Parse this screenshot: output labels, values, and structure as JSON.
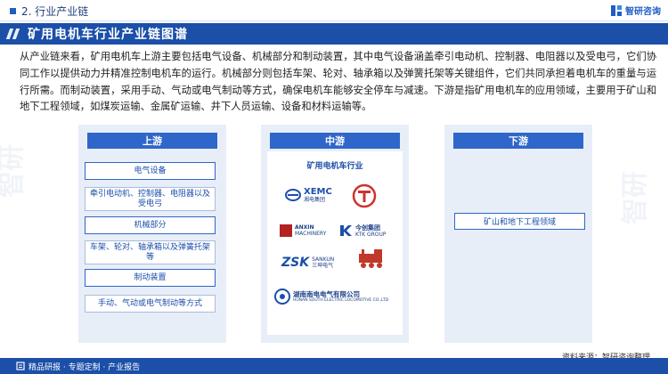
{
  "header": {
    "section": "2. 行业产业链",
    "brand": "智研咨询"
  },
  "title": "矿用电机车行业产业链图谱",
  "intro": "从产业链来看，矿用电机车上游主要包括电气设备、机械部分和制动装置，其中电气设备涵盖牵引电动机、控制器、电阻器以及受电弓，它们协同工作以提供动力并精准控制电机车的运行。机械部分则包括车架、轮对、轴承箱以及弹簧托架等关键组件，它们共同承担着电机车的重量与运行所需。而制动装置，采用手动、气动或电气制动等方式，确保电机车能够安全停车与减速。下游是指矿用电机车的应用领域，主要用于矿山和地下工程领域，如煤炭运输、金属矿运输、井下人员运输、设备和材料运输等。",
  "upstream": {
    "label": "上游",
    "items": [
      {
        "category": "电气设备",
        "detail": "牵引电动机、控制器、电阻器以及受电弓"
      },
      {
        "category": "机械部分",
        "detail": "车架、轮对、轴承箱以及弹簧托架等"
      },
      {
        "category": "制动装置",
        "detail": "手动、气动或电气制动等方式"
      }
    ]
  },
  "midstream": {
    "label": "中游",
    "industry": "矿用电机车行业",
    "logos": {
      "xemc_en": "XEMC",
      "xemc_cn": "湘电集团",
      "anxin_en": "ANXIN",
      "anxin_en2": "MACHINERY",
      "ktk_cn": "今创集团",
      "ktk_en": "KTK GROUP",
      "zsk": "ZSK",
      "sankun_en": "SANKUN",
      "sankun_cn": "三坤电气",
      "hunan_cn": "湖南南电电气有限公司",
      "hunan_en": "HUNAN SOUTH ELECTRIC LOCOMOTIVE CO.,LTD"
    }
  },
  "downstream": {
    "label": "下游",
    "items": [
      "矿山和地下工程领域"
    ]
  },
  "source": "资料来源：智研咨询整理",
  "footer": "精品研报 · 专题定制 · 产业报告",
  "colors": {
    "primary": "#1b4fa8",
    "accent": "#2f66c9",
    "panel": "#e8eef8"
  }
}
